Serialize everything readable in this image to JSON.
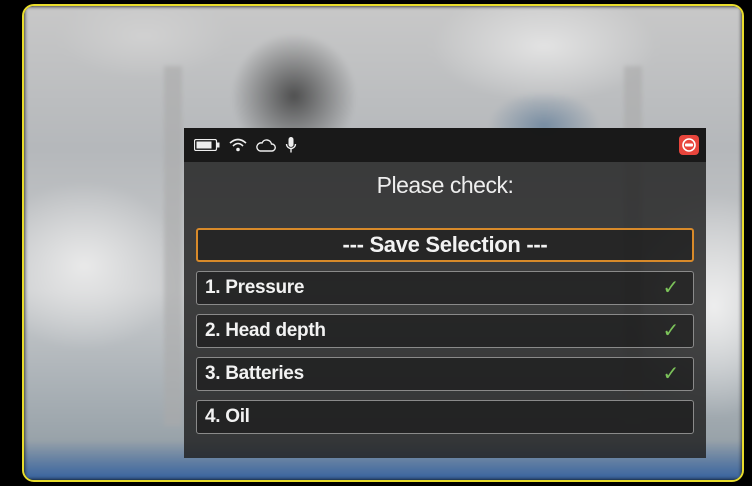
{
  "overlay": {
    "title": "Please check:",
    "status_icons": [
      "battery-icon",
      "wifi-icon",
      "cloud-icon",
      "microphone-icon"
    ],
    "app_badge_icon": "app-logo-icon",
    "items": [
      {
        "label": "--- Save Selection ---",
        "selected": true,
        "checked": false
      },
      {
        "label": "1. Pressure",
        "selected": false,
        "checked": true,
        "check": "✓"
      },
      {
        "label": "2. Head depth",
        "selected": false,
        "checked": true,
        "check": "✓"
      },
      {
        "label": "3. Batteries",
        "selected": false,
        "checked": true,
        "check": "✓"
      },
      {
        "label": "4. Oil",
        "selected": false,
        "checked": false
      }
    ]
  },
  "colors": {
    "frame_border": "#e9dd2c",
    "selection_border": "#d88a2a",
    "check": "#7cc35a",
    "badge": "#e8453c"
  }
}
